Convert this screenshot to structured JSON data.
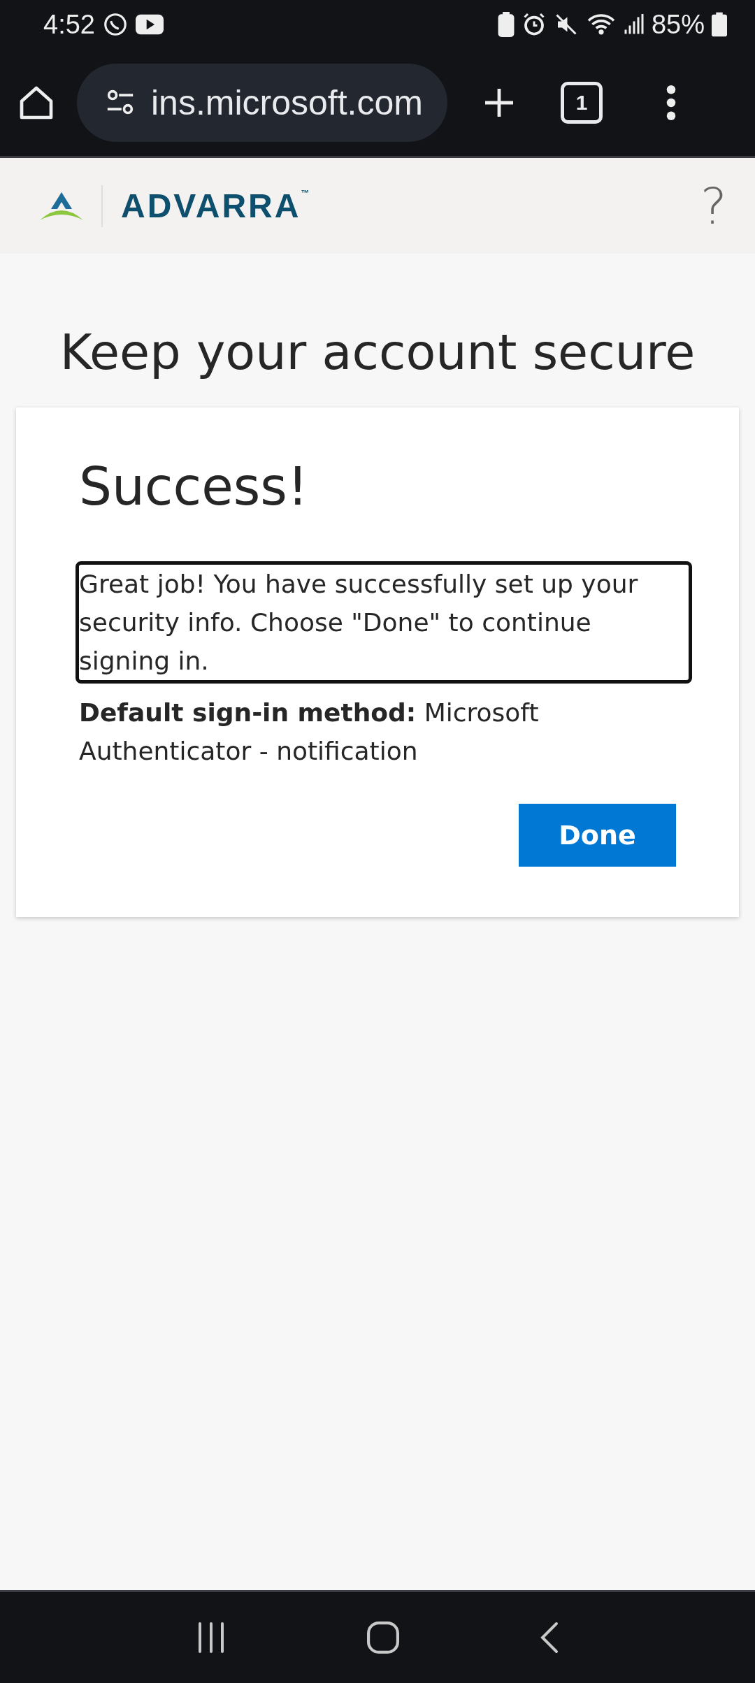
{
  "status_bar": {
    "time": "4:52",
    "battery": "85%"
  },
  "browser": {
    "url": "ins.microsoft.com",
    "tab_count": "1"
  },
  "header": {
    "logo": "ADVARRA",
    "trademark": "™",
    "help": "?"
  },
  "page_title": "Keep your account secure",
  "card": {
    "title": "Success!",
    "message": {
      "text": "Great job! You have successfully set up your security info. Choose \"Done\" to continue signing in.",
      "focused": true
    },
    "method": "**Default sign-in method:** Microsoft Authenticator - notification",
    "button": "Done"
  }
}
